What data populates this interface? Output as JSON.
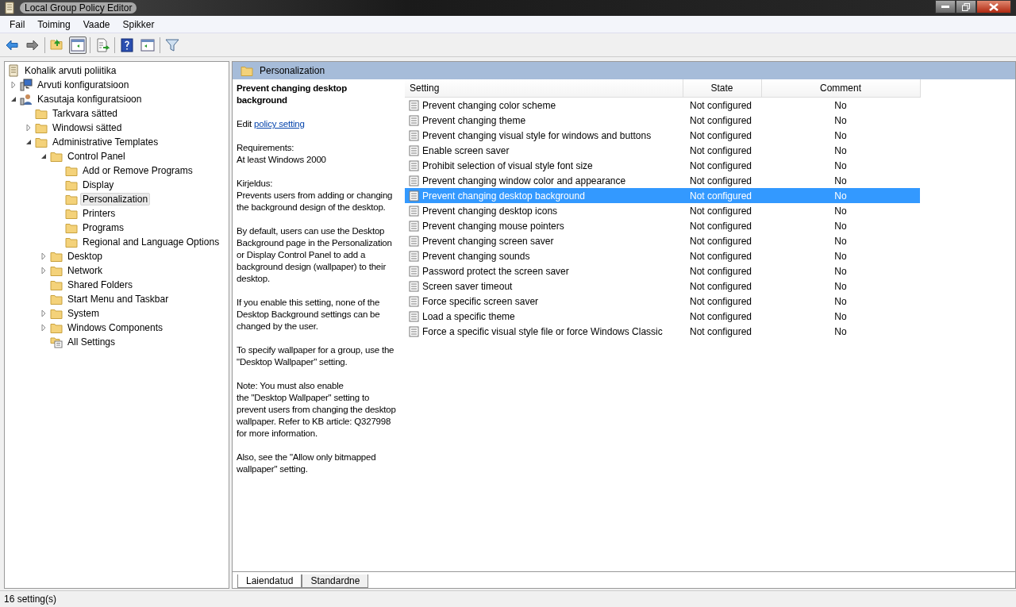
{
  "window": {
    "title": "Local Group Policy Editor"
  },
  "menu": [
    "Fail",
    "Toiming",
    "Vaade",
    "Spikker"
  ],
  "toolbar": [
    {
      "kind": "back"
    },
    {
      "kind": "forward"
    },
    {
      "kind": "sep"
    },
    {
      "kind": "up"
    },
    {
      "kind": "tree",
      "selected": true
    },
    {
      "kind": "sep"
    },
    {
      "kind": "export"
    },
    {
      "kind": "sep"
    },
    {
      "kind": "help"
    },
    {
      "kind": "pane",
      "selected": false
    },
    {
      "kind": "sep"
    },
    {
      "kind": "filter"
    }
  ],
  "tree": [
    {
      "label": "Kohalik arvuti poliitika",
      "kind": "root",
      "selected": false,
      "children": [
        {
          "label": "Arvuti konfiguratsioon",
          "kind": "computer",
          "expanded": false,
          "selected": false
        },
        {
          "label": "Kasutaja konfiguratsioon",
          "kind": "user",
          "expanded": true,
          "selected": false,
          "children": [
            {
              "label": "Tarkvara sätted",
              "kind": "folder",
              "selected": false
            },
            {
              "label": "Windowsi sätted",
              "kind": "folder",
              "expanded": false,
              "selected": false
            },
            {
              "label": "Administrative Templates",
              "kind": "folder",
              "expanded": true,
              "selected": false,
              "children": [
                {
                  "label": "Control Panel",
                  "kind": "folder",
                  "expanded": true,
                  "selected": false,
                  "children": [
                    {
                      "label": "Add or Remove Programs",
                      "kind": "folder",
                      "selected": false
                    },
                    {
                      "label": "Display",
                      "kind": "folder",
                      "selected": false
                    },
                    {
                      "label": "Personalization",
                      "kind": "folder",
                      "selected": true
                    },
                    {
                      "label": "Printers",
                      "kind": "folder",
                      "selected": false
                    },
                    {
                      "label": "Programs",
                      "kind": "folder",
                      "selected": false
                    },
                    {
                      "label": "Regional and Language Options",
                      "kind": "folder",
                      "selected": false
                    }
                  ]
                },
                {
                  "label": "Desktop",
                  "kind": "folder",
                  "expanded": false,
                  "selected": false
                },
                {
                  "label": "Network",
                  "kind": "folder",
                  "expanded": false,
                  "selected": false
                },
                {
                  "label": "Shared Folders",
                  "kind": "folder",
                  "selected": false
                },
                {
                  "label": "Start Menu and Taskbar",
                  "kind": "folder",
                  "selected": false
                },
                {
                  "label": "System",
                  "kind": "folder",
                  "expanded": false,
                  "selected": false
                },
                {
                  "label": "Windows Components",
                  "kind": "folder",
                  "expanded": false,
                  "selected": false
                },
                {
                  "label": "All Settings",
                  "kind": "all-settings",
                  "selected": false
                }
              ]
            }
          ]
        }
      ]
    }
  ],
  "header": {
    "title": "Personalization"
  },
  "description": {
    "title": "Prevent changing desktop background",
    "edit_prefix": "Edit",
    "edit_link": "policy setting",
    "paragraphs": [
      "Requirements:\nAt least Windows 2000",
      "Kirjeldus:\nPrevents users from adding or changing the background design of the desktop.",
      "By default, users can use the Desktop Background page in the Personalization or Display Control Panel to add a background design (wallpaper) to their desktop.",
      "If you enable this setting, none of the Desktop Background settings can be changed by the user.",
      "To specify wallpaper for a group, use the \"Desktop Wallpaper\" setting.",
      "Note: You must also enable\nthe \"Desktop Wallpaper\" setting to prevent users from changing the desktop wallpaper. Refer to KB article: Q327998 for more information.",
      "Also, see the \"Allow only bitmapped wallpaper\" setting."
    ]
  },
  "table": {
    "columns": [
      "Setting",
      "State",
      "Comment"
    ],
    "rows": [
      {
        "setting": "Prevent changing color scheme",
        "state": "Not configured",
        "comment": "No",
        "selected": false
      },
      {
        "setting": "Prevent changing theme",
        "state": "Not configured",
        "comment": "No",
        "selected": false
      },
      {
        "setting": "Prevent changing visual style for windows and buttons",
        "state": "Not configured",
        "comment": "No",
        "selected": false
      },
      {
        "setting": "Enable screen saver",
        "state": "Not configured",
        "comment": "No",
        "selected": false
      },
      {
        "setting": "Prohibit selection of visual style font size",
        "state": "Not configured",
        "comment": "No",
        "selected": false
      },
      {
        "setting": "Prevent changing window color and appearance",
        "state": "Not configured",
        "comment": "No",
        "selected": false
      },
      {
        "setting": "Prevent changing desktop background",
        "state": "Not configured",
        "comment": "No",
        "selected": true
      },
      {
        "setting": "Prevent changing desktop icons",
        "state": "Not configured",
        "comment": "No",
        "selected": false
      },
      {
        "setting": "Prevent changing mouse pointers",
        "state": "Not configured",
        "comment": "No",
        "selected": false
      },
      {
        "setting": "Prevent changing screen saver",
        "state": "Not configured",
        "comment": "No",
        "selected": false
      },
      {
        "setting": "Prevent changing sounds",
        "state": "Not configured",
        "comment": "No",
        "selected": false
      },
      {
        "setting": "Password protect the screen saver",
        "state": "Not configured",
        "comment": "No",
        "selected": false
      },
      {
        "setting": "Screen saver timeout",
        "state": "Not configured",
        "comment": "No",
        "selected": false
      },
      {
        "setting": "Force specific screen saver",
        "state": "Not configured",
        "comment": "No",
        "selected": false
      },
      {
        "setting": "Load a specific theme",
        "state": "Not configured",
        "comment": "No",
        "selected": false
      },
      {
        "setting": "Force a specific visual style file or force Windows Classic",
        "state": "Not configured",
        "comment": "No",
        "selected": false
      }
    ]
  },
  "tabs": [
    {
      "label": "Laiendatud",
      "selected": true
    },
    {
      "label": "Standardne",
      "selected": false
    }
  ],
  "status_bar": {
    "text": "16 setting(s)"
  }
}
